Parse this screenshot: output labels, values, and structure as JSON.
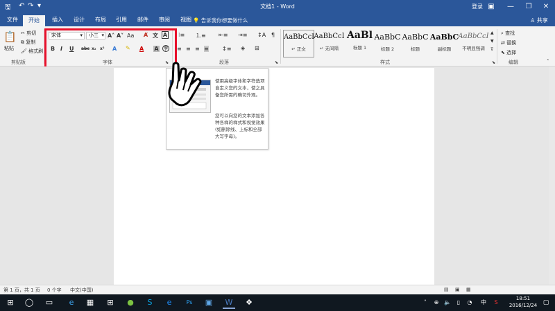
{
  "window": {
    "title": "文档1 - Word",
    "login": "登录",
    "quick_access": {
      "save_icon": "save-icon",
      "undo_icon": "undo-icon",
      "redo_icon": "redo-icon",
      "customize_icon": "customize-icon"
    }
  },
  "tabs": [
    "文件",
    "开始",
    "插入",
    "设计",
    "布局",
    "引用",
    "邮件",
    "审阅",
    "视图"
  ],
  "tell_me": "告诉我你想要做什么",
  "share": "共享",
  "clipboard": {
    "paste": "粘贴",
    "cut": "剪切",
    "copy": "复制",
    "format_painter": "格式刷",
    "label": "剪贴板"
  },
  "font": {
    "font_name": "宋体",
    "font_size": "小三",
    "label": "字体",
    "buttons": [
      "B",
      "I",
      "U",
      "abc",
      "x₂",
      "x²"
    ],
    "grow": "A˄",
    "shrink": "A˅",
    "case": "Aa"
  },
  "paragraph": {
    "label": "段落"
  },
  "styles": {
    "label": "样式",
    "items": [
      {
        "sample": "AaBbCcI",
        "name": "↵ 正文"
      },
      {
        "sample": "AaBbCcI",
        "name": "↵ 无间隔"
      },
      {
        "sample": "AaBl",
        "name": "标题 1"
      },
      {
        "sample": "AaBbC",
        "name": "标题 2"
      },
      {
        "sample": "AaBbC",
        "name": "标题"
      },
      {
        "sample": "AaBbC",
        "name": "副标题"
      },
      {
        "sample": "AaBbCcI",
        "name": "不明显强调"
      }
    ]
  },
  "editing": {
    "label": "编辑",
    "find": "查找",
    "replace": "替换",
    "select": "选择"
  },
  "tooltip": {
    "text1": "使用高级字体和字符选项自定义您的文本，使之具备您所需的确切外观。",
    "text2": "您可以向您的文本添加各种各样的样式和视觉效果(如删除线、上标和全部大写字母)。"
  },
  "status": {
    "page": "第 1 页，共 1 页",
    "words": "0 个字",
    "lang": "中文(中国)"
  },
  "taskbar": {
    "time": "18:51",
    "date": "2016/12/24",
    "ime": "中"
  },
  "colors": {
    "word_blue": "#2b579a",
    "highlight_red": "#e8102b"
  }
}
